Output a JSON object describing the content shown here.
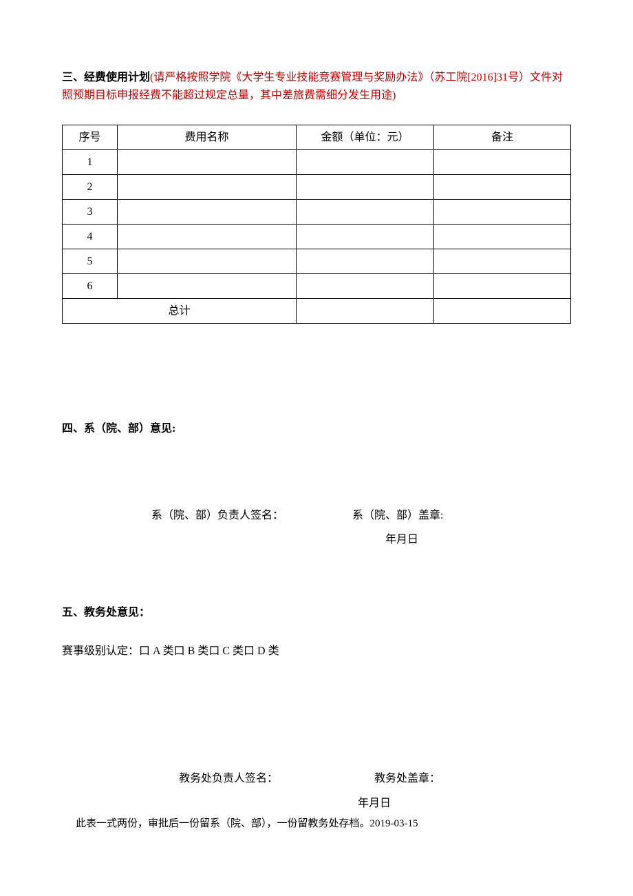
{
  "section3": {
    "title": "三、经费使用计划",
    "note": "(请严格按照学院《大学生专业技能竞赛管理与奖励办法》（苏工院[2016]31号）文件对照预期目标申报经费不能超过规定总量，其中差旅费需细分发生用途)",
    "table": {
      "headers": {
        "seq": "序号",
        "name": "费用名称",
        "amount": "金额（单位：元）",
        "remark": "备注"
      },
      "rows": [
        {
          "seq": "1",
          "name": "",
          "amount": "",
          "remark": ""
        },
        {
          "seq": "2",
          "name": "",
          "amount": "",
          "remark": ""
        },
        {
          "seq": "3",
          "name": "",
          "amount": "",
          "remark": ""
        },
        {
          "seq": "4",
          "name": "",
          "amount": "",
          "remark": ""
        },
        {
          "seq": "5",
          "name": "",
          "amount": "",
          "remark": ""
        },
        {
          "seq": "6",
          "name": "",
          "amount": "",
          "remark": ""
        }
      ],
      "total_label": "总计",
      "total_amount": "",
      "total_remark": ""
    }
  },
  "section4": {
    "heading": "四、系（院、部）意见:",
    "sig_left": "系（院、部）负责人签名：",
    "sig_right": "系（院、部）盖章:",
    "date": "年月日"
  },
  "section5": {
    "heading": "五、教务处意见：",
    "event_level": "赛事级别认定：口 A 类口 B 类口 C 类口 D 类",
    "sig_left": "教务处负责人签名：",
    "sig_right": "教务处盖章：",
    "date": "年月日"
  },
  "footer": "此表一式两份，审批后一份留系（院、部），一份留教务处存档。2019-03-15"
}
